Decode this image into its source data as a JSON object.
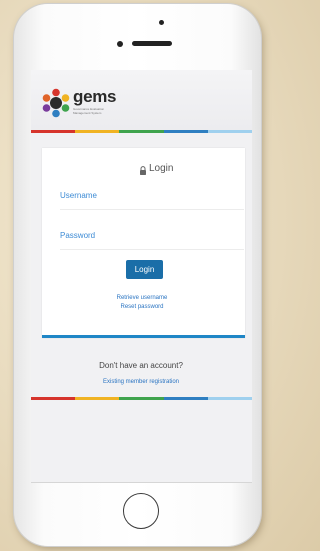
{
  "brand": {
    "logo_text": "gems",
    "logo_subtext": "Governance Evaluation Management System"
  },
  "login_card": {
    "title": "Login",
    "username_label": "Username",
    "password_label": "Password",
    "login_button": "Login",
    "retrieve_username_link": "Retrieve username",
    "reset_password_link": "Reset password"
  },
  "footer": {
    "no_account_text": "Don't have an account?",
    "registration_link": "Existing member registration"
  },
  "colors": {
    "accent_blue": "#1a6ea8",
    "link_blue": "#2a74c2",
    "bar_red": "#d6342c",
    "bar_yellow": "#f0b323",
    "bar_green": "#3fa34d",
    "bar_blue": "#2f7fc1",
    "bar_lightblue": "#9fd0ee"
  },
  "icons": [
    "lock-icon",
    "gems-logo-icon",
    "home-button-icon"
  ]
}
